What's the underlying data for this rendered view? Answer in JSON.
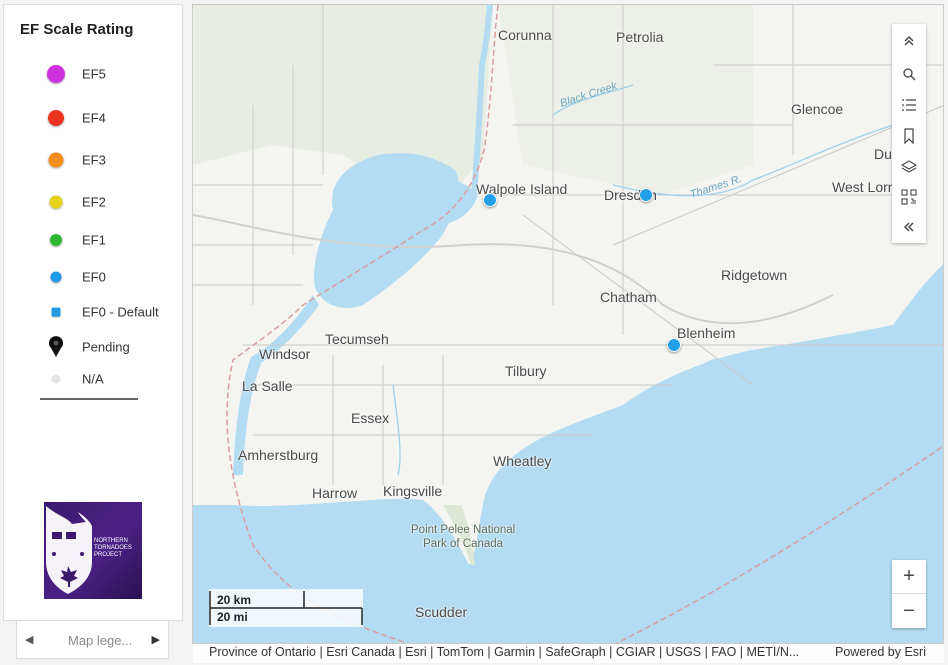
{
  "legend": {
    "title": "EF Scale Rating",
    "items": [
      {
        "label": "EF5",
        "color": "#cc33dd"
      },
      {
        "label": "EF4",
        "color": "#ee3322"
      },
      {
        "label": "EF3",
        "color": "#f28c1c"
      },
      {
        "label": "EF2",
        "color": "#e6d21a"
      },
      {
        "label": "EF1",
        "color": "#2fb52f"
      },
      {
        "label": "EF0",
        "color": "#1f9be6"
      },
      {
        "label": "EF0 - Default",
        "color": "#1f9be6"
      },
      {
        "label": "Pending",
        "color": "#111111"
      },
      {
        "label": "N/A",
        "color": "#e4e4e4"
      }
    ],
    "logo_text": "NORTHERN TORNADOES PROJECT"
  },
  "pager": {
    "label": "Map lege...",
    "prev_icon": "chevron-left-icon",
    "next_icon": "chevron-right-icon"
  },
  "map": {
    "places": {
      "corunna": "Corunna",
      "petrolia": "Petrolia",
      "glencoe": "Glencoe",
      "du": "Du",
      "west_lorne": "West Lorn",
      "walpole_island": "Walpole Island",
      "dresden": "Dresden",
      "ridgetown": "Ridgetown",
      "chatham": "Chatham",
      "blenheim": "Blenheim",
      "tecumseh": "Tecumseh",
      "windsor": "Windsor",
      "la_salle": "La Salle",
      "tilbury": "Tilbury",
      "essex": "Essex",
      "amherstburg": "Amherstburg",
      "wheatley": "Wheatley",
      "harrow": "Harrow",
      "kingsville": "Kingsville",
      "point_pelee": "Point Pelee National",
      "park_of_canada": "Park of Canada",
      "scudder": "Scudder",
      "black_creek": "Black Creek",
      "thames_river": "Thames R."
    },
    "markers_note": "EF0"
  },
  "toolbar": {
    "tools": [
      "chevrons-up-icon",
      "search-icon",
      "list-icon",
      "bookmark-icon",
      "layers-icon",
      "qr-code-icon",
      "chevrons-left-icon"
    ]
  },
  "zoom": {
    "in": "+",
    "out": "−"
  },
  "scalebar": {
    "km": "20 km",
    "mi": "20 mi"
  },
  "attribution": {
    "text": "Province of Ontario | Esri Canada | Esri | TomTom | Garmin | SafeGraph | CGIAR | USGS | FAO | METI/N...",
    "powered": "Powered by Esri"
  }
}
